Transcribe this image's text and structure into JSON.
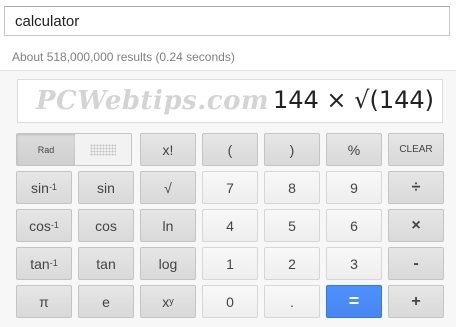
{
  "search": {
    "query": "calculator"
  },
  "stats": {
    "text": "About 518,000,000 results (0.24 seconds)"
  },
  "display": {
    "watermark": "PCWebtips.com",
    "expression": "144 × √(144)"
  },
  "keys": {
    "rad": "Rad",
    "fact": "x!",
    "lparen": "(",
    "rparen": ")",
    "percent": "%",
    "clear": "CLEAR",
    "asin_base": "sin",
    "asin_exp": "-1",
    "sin": "sin",
    "sqrt": "√",
    "d7": "7",
    "d8": "8",
    "d9": "9",
    "divide": "÷",
    "acos_base": "cos",
    "acos_exp": "-1",
    "cos": "cos",
    "ln": "ln",
    "d4": "4",
    "d5": "5",
    "d6": "6",
    "multiply": "×",
    "atan_base": "tan",
    "atan_exp": "-1",
    "tan": "tan",
    "log": "log",
    "d1": "1",
    "d2": "2",
    "d3": "3",
    "minus": "-",
    "pi": "π",
    "e": "e",
    "pow_base": "x",
    "pow_exp": "y",
    "d0": "0",
    "dot": ".",
    "equals": "=",
    "plus": "+"
  },
  "colors": {
    "accent": "#4d90fe",
    "function_key": "#dcdcdc",
    "number_key": "#f3f3f3"
  }
}
